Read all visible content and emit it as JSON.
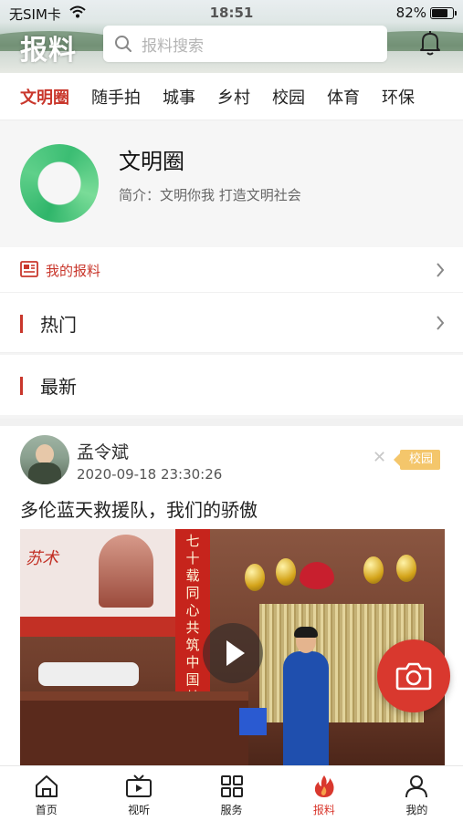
{
  "status_bar": {
    "carrier": "无SIM卡",
    "time": "18:51",
    "battery": "82%",
    "battery_level": 0.82
  },
  "header": {
    "title": "报料",
    "search_placeholder": "报料搜索"
  },
  "tabs": [
    {
      "label": "文明圈",
      "active": true
    },
    {
      "label": "随手拍"
    },
    {
      "label": "城事"
    },
    {
      "label": "乡村"
    },
    {
      "label": "校园"
    },
    {
      "label": "体育"
    },
    {
      "label": "环保"
    }
  ],
  "circle": {
    "name": "文明圈",
    "description": "简介：文明你我  打造文明社会"
  },
  "my_report": {
    "label": "我的报料"
  },
  "sections": {
    "hot": "热门",
    "latest": "最新"
  },
  "post": {
    "author": "孟令斌",
    "time": "2020-09-18 23:30:26",
    "tag": "校园",
    "title": "多伦蓝天救援队，我们的骄傲",
    "video_text": {
      "screen_text": "苏术",
      "banner": "七十载同心共筑中国梦"
    }
  },
  "bottom_nav": [
    {
      "label": "首页",
      "icon": "home-icon"
    },
    {
      "label": "视听",
      "icon": "tv-icon"
    },
    {
      "label": "服务",
      "icon": "grid-icon"
    },
    {
      "label": "报料",
      "icon": "flame-icon",
      "active": true
    },
    {
      "label": "我的",
      "icon": "user-icon"
    }
  ],
  "colors": {
    "accent": "#c9372c",
    "fab": "#d9382e",
    "tag": "#f4c66b",
    "logo": "#2fb56a"
  }
}
